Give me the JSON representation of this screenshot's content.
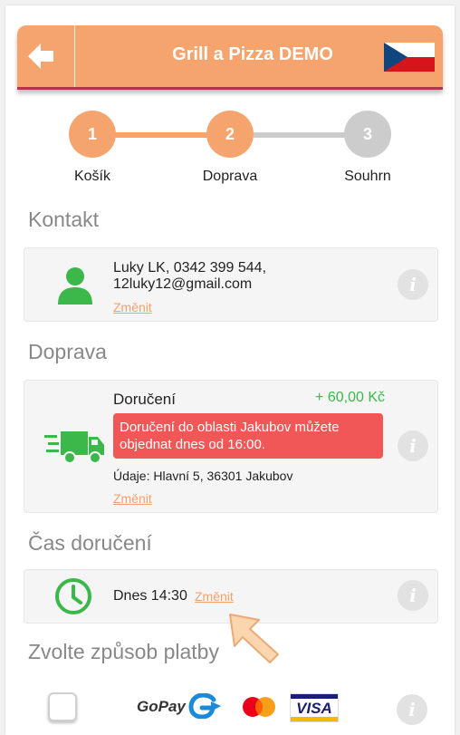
{
  "header": {
    "title": "Grill a Pizza DEMO",
    "back_icon": "arrow-left-icon",
    "flag_icon": "czech-flag-icon",
    "accent_color": "#f6a46e",
    "underline_color": "#b0354c"
  },
  "stepper": {
    "steps": [
      {
        "number": "1",
        "label": "Košík",
        "state": "done"
      },
      {
        "number": "2",
        "label": "Doprava",
        "state": "active"
      },
      {
        "number": "3",
        "label": "Souhrn",
        "state": "pending"
      }
    ],
    "active_color": "#f6a46e",
    "pending_color": "#cccccc"
  },
  "contact": {
    "section_title": "Kontakt",
    "icon": "user-icon",
    "line1": "Luky LK, 0342 399 544,",
    "line2": "12luky12@gmail.com",
    "change_label": "Změnit",
    "info_label": "i"
  },
  "delivery": {
    "section_title": "Doprava",
    "icon": "delivery-truck-icon",
    "method": "Doručení",
    "price": "+ 60,00 Kč",
    "alert": "Doručení do oblasti Jakubov můžete objednat dnes od 16:00.",
    "details": "Údaje: Hlavní 5, 36301 Jakubov",
    "change_label": "Změnit",
    "info_label": "i",
    "price_color": "#3cb84a",
    "alert_color": "#f25757"
  },
  "delivery_time": {
    "section_title": "Čas doručení",
    "icon": "clock-icon",
    "value": "Dnes 14:30",
    "change_label": "Změnit",
    "info_label": "i"
  },
  "payment": {
    "section_title": "Zvolte způsob platby",
    "gopay_label": "GoPay",
    "visa_label": "VISA",
    "info_label": "i",
    "checked": false
  }
}
